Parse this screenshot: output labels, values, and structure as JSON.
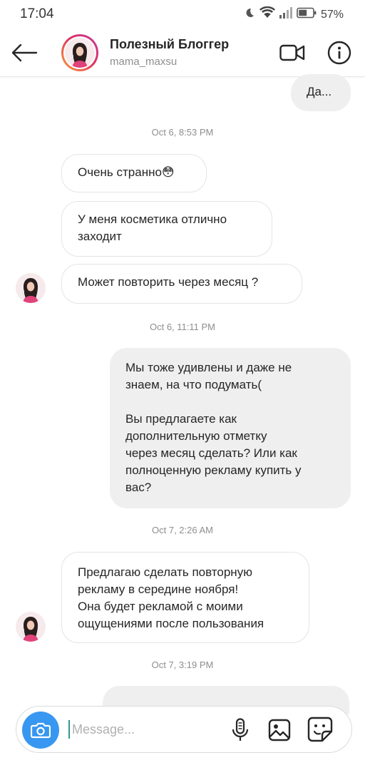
{
  "status_bar": {
    "time": "17:04",
    "battery": "57%"
  },
  "header": {
    "name": "Полезный Блоггер",
    "handle": "mama_maxsu"
  },
  "messages": [
    {
      "dir": "out",
      "text": "Да..."
    },
    {
      "timestamp": "Oct 6, 8:53 PM"
    },
    {
      "dir": "in",
      "text": "Очень странно😳"
    },
    {
      "dir": "in",
      "text": "У меня косметика отлично\nзаходит"
    },
    {
      "dir": "in",
      "text": "Может повторить через месяц ?"
    },
    {
      "timestamp": "Oct 6, 11:11 PM"
    },
    {
      "dir": "out",
      "text": "Мы тоже удивлены и даже не\nзнаем, на что подумать(\n\nВы предлагаете как\nдополнительную отметку\nчерез месяц сделать? Или как\nполноценную рекламу купить у\nвас?"
    },
    {
      "timestamp": "Oct 7, 2:26 AM"
    },
    {
      "dir": "in",
      "text": "Предлагаю сделать повторную\nрекламу в середине ноября!\nОна будет рекламой с моими\nощущениями после пользования"
    },
    {
      "timestamp": "Oct 7, 3:19 PM"
    }
  ],
  "composer": {
    "placeholder": "Message..."
  },
  "colors": {
    "accent": "#3897f0",
    "outgoing_bubble": "#efefef",
    "timestamp": "#8e8e8e"
  }
}
